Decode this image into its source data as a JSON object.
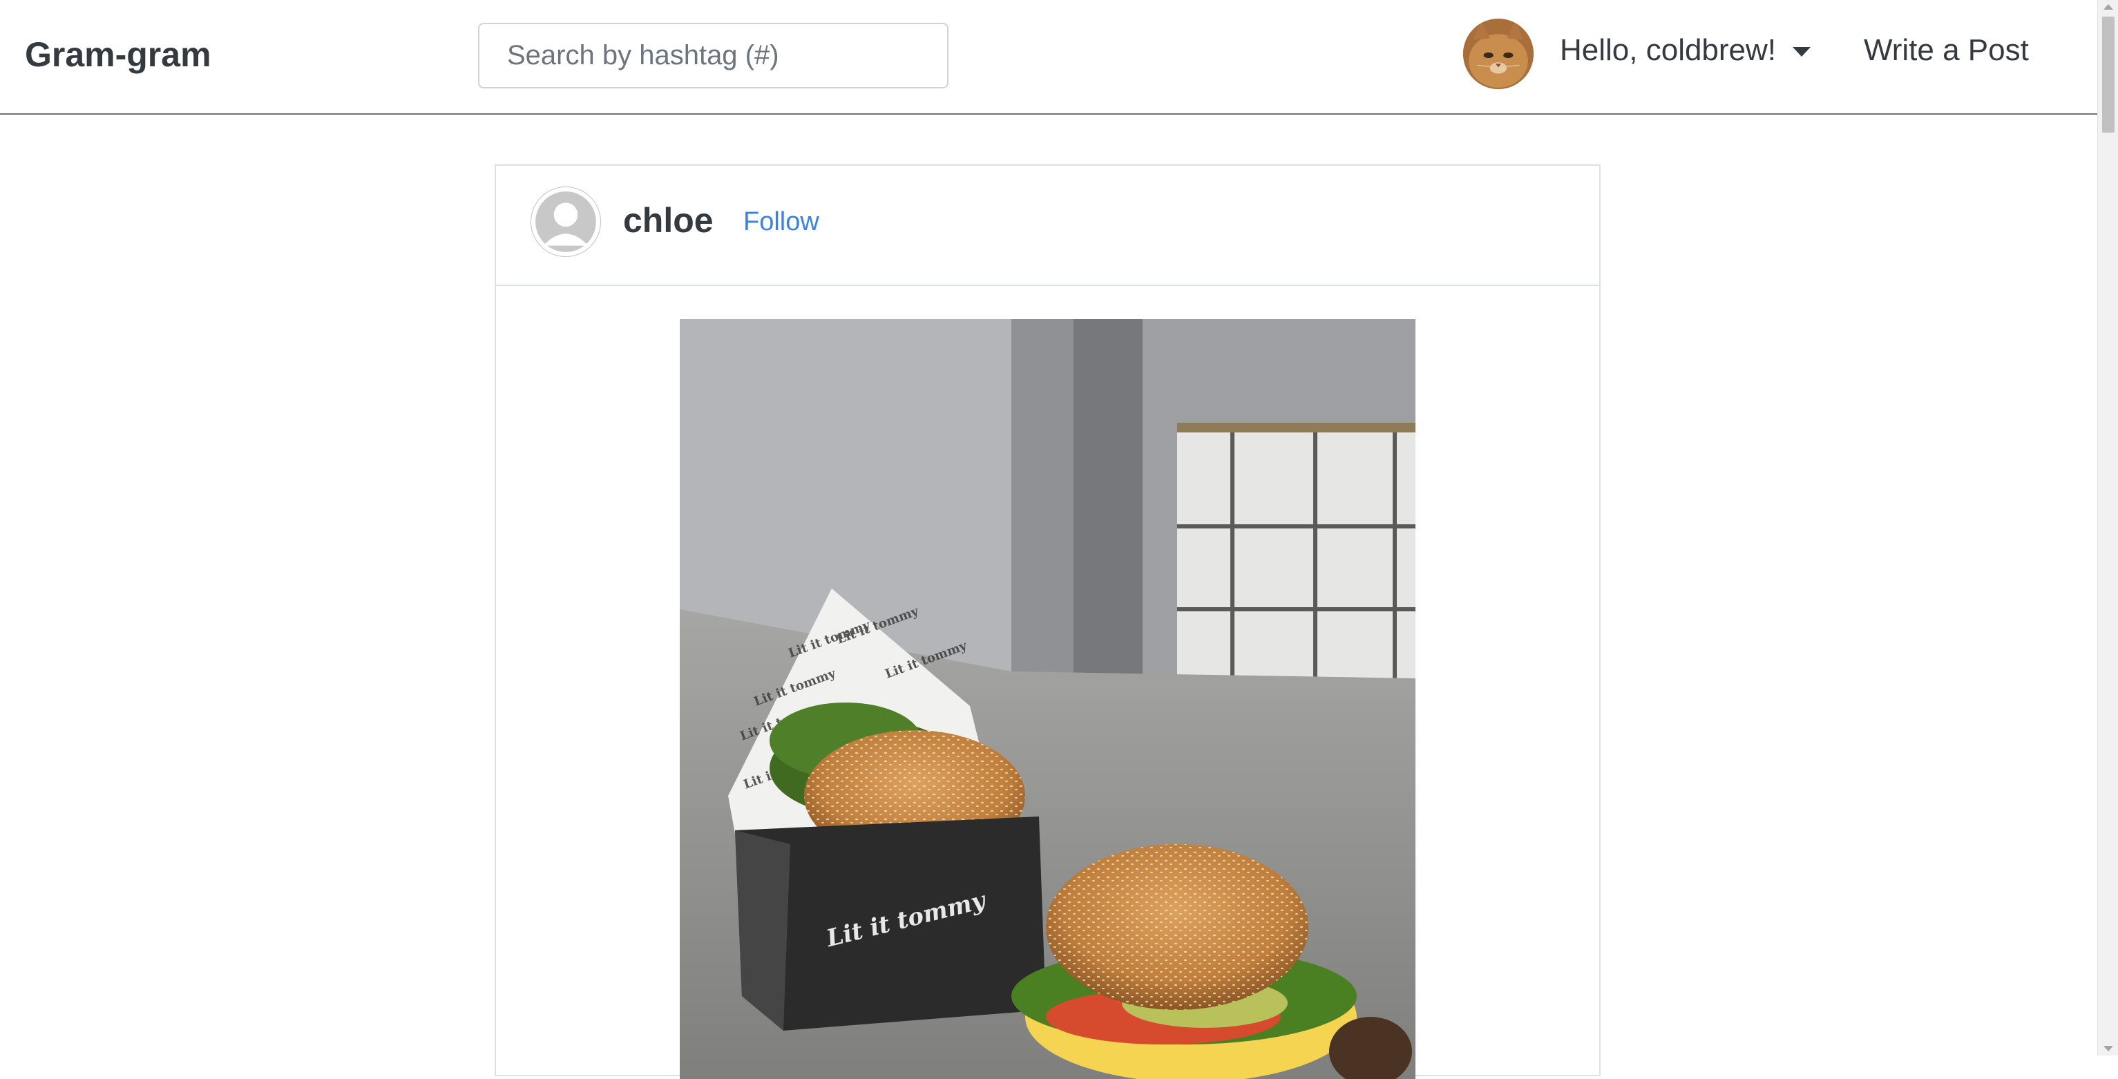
{
  "navbar": {
    "brand": "Gram-gram",
    "search_placeholder": "Search by hashtag (#)",
    "user_greeting": "Hello, coldbrew!",
    "write_post_label": "Write a Post"
  },
  "post": {
    "author": "chloe",
    "follow_label": "Follow",
    "photo_box_text": "Lit it tommy"
  },
  "icons": {
    "user_avatar": "cat-avatar-icon",
    "author_avatar": "default-user-icon",
    "dropdown": "caret-down-icon"
  },
  "colors": {
    "link": "#3b82e6",
    "text": "#343a40",
    "border": "#dee2e6"
  }
}
